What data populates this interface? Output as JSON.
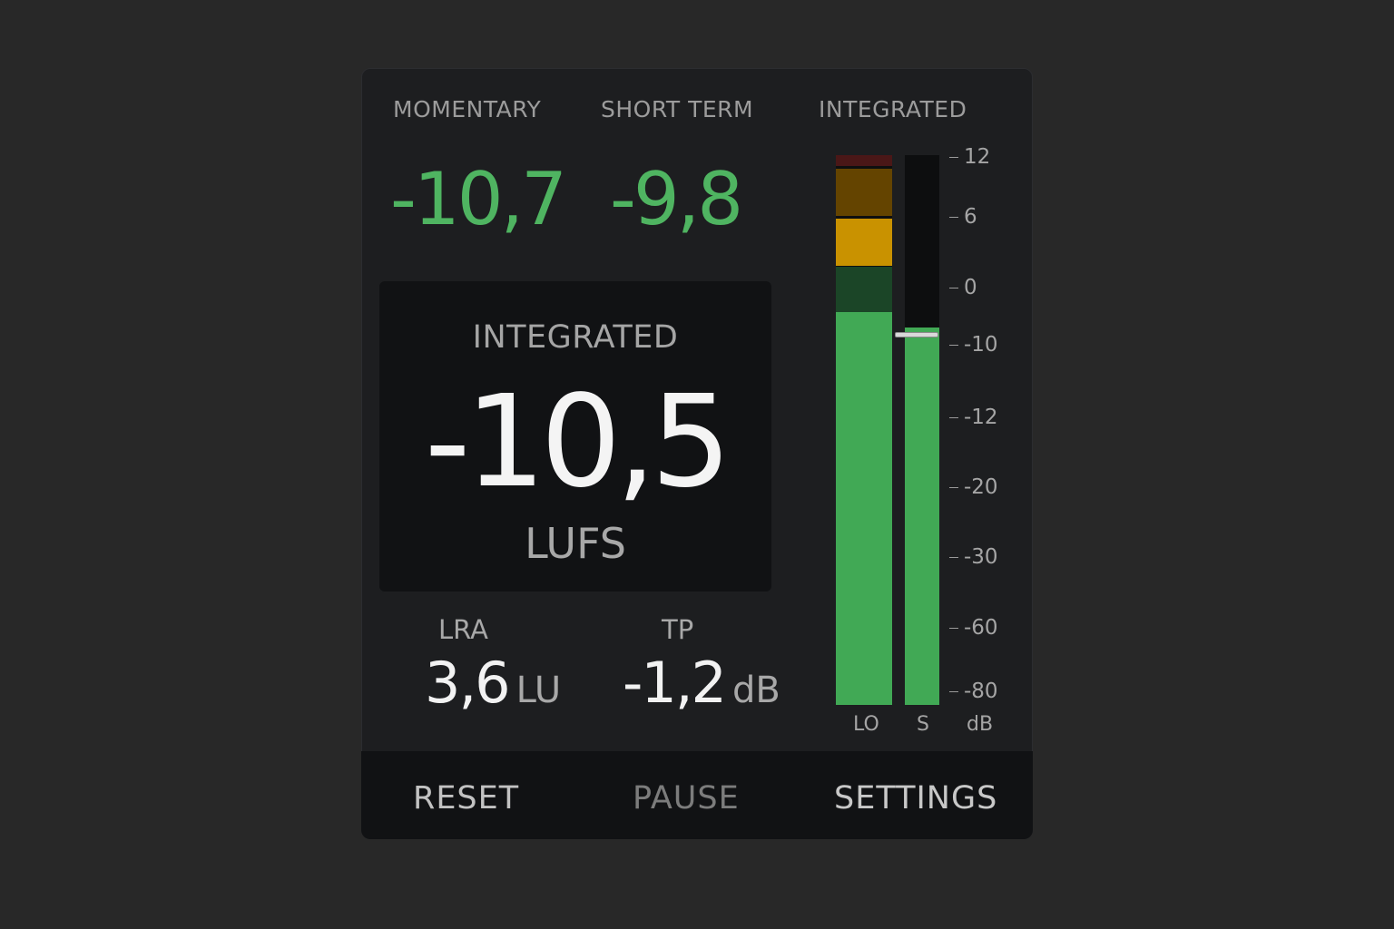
{
  "readouts": {
    "momentary": {
      "label": "MOMENTARY",
      "value": "-10,7"
    },
    "short_term": {
      "label": "SHORT TERM",
      "value": "-9,8"
    },
    "integrated_header": {
      "label": "INTEGRATED"
    }
  },
  "integrated": {
    "label": "INTEGRATED",
    "value": "-10,5",
    "unit": "LUFS"
  },
  "lra": {
    "label": "LRA",
    "value": "3,6",
    "unit": "LU"
  },
  "tp": {
    "label": "TP",
    "value": "-1,2",
    "unit": "dB"
  },
  "meter": {
    "scale_labels": [
      "12",
      "6",
      "0",
      "-10",
      "-12",
      "-20",
      "-30",
      "-60",
      "-80"
    ],
    "channel_labels": {
      "lo": "LO",
      "s": "S",
      "unit": "dB"
    },
    "colors": {
      "green": "#41a955",
      "dark_green": "#1b4527",
      "amber": "#c99200",
      "dark_amber": "#644400",
      "dark_red": "#4a1717"
    }
  },
  "footer": {
    "reset": "RESET",
    "pause": "PAUSE",
    "settings": "SETTINGS"
  }
}
